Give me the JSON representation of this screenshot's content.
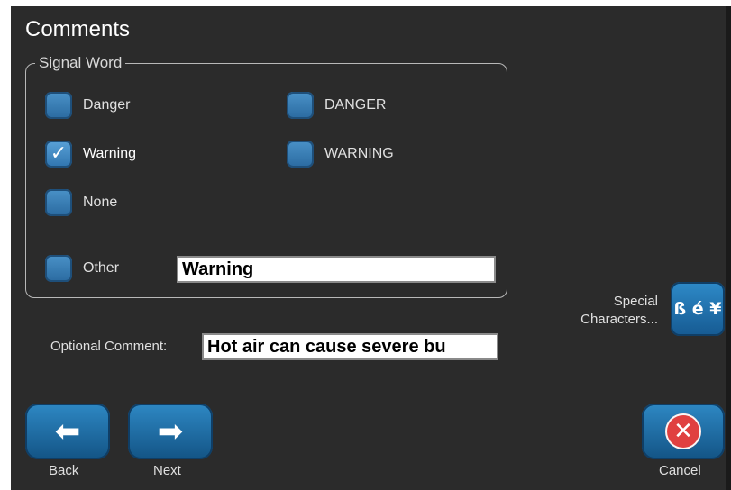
{
  "title": "Comments",
  "signal_group": {
    "legend": "Signal Word",
    "options": [
      {
        "label": "Danger",
        "checked": false
      },
      {
        "label": "DANGER",
        "checked": false
      },
      {
        "label": "Warning",
        "checked": true
      },
      {
        "label": "WARNING",
        "checked": false
      },
      {
        "label": "None",
        "checked": false
      },
      {
        "label": "Other",
        "checked": false
      }
    ],
    "other_value": "Warning"
  },
  "optional_comment": {
    "label": "Optional Comment:",
    "value": "Hot air can cause severe bu"
  },
  "special_characters": {
    "label_line1": "Special",
    "label_line2": "Characters...",
    "icon_glyph": "ß é ¥"
  },
  "nav": {
    "back_label": "Back",
    "next_label": "Next",
    "cancel_label": "Cancel"
  },
  "icons": {
    "checkmark": "✓",
    "back_arrow": "⬅",
    "next_arrow": "➡",
    "cancel_x": "✕"
  },
  "colors": {
    "background": "#2b2b2b",
    "button_blue": "#2e88c4",
    "cancel_red": "#e04040"
  }
}
